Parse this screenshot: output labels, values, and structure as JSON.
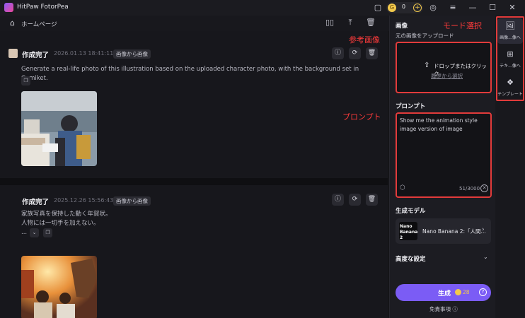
{
  "app": {
    "title": "HitPaw FotorPea"
  },
  "titlebar": {
    "coins": "0"
  },
  "toolbar": {
    "home_label": "ホームページ"
  },
  "cards": [
    {
      "status": "作成完了",
      "time": "2026.01.13 18:41:11",
      "badge": "画像から画像",
      "prompt": "Generate a real-life photo of this illustration based on the uploaded character photo, with the background set in Comiket."
    },
    {
      "status": "作成完了",
      "time": "2025.12.26 15:56:43",
      "badge": "画像から画像",
      "prompt_line1": "家族写真を保持した動く年賀状。",
      "prompt_line2": "人物には一切手を加えない。",
      "ellipsis": "..."
    }
  ],
  "panel": {
    "image_label": "画像",
    "upload_sub": "元の画像をアップロード",
    "upload_text": "ドロップまたはクリック",
    "upload_history": "履歴から選択",
    "prompt_label": "プロンプト",
    "prompt_value": "Show me the animation style image version of image",
    "prompt_count": "51/3000",
    "model_label": "生成モデル",
    "model_name": "Nano Banana 2:「人間...",
    "model_thumb_line1": "Nano",
    "model_thumb_line2": "Banana 2",
    "advanced_label": "高度な設定",
    "generate_label": "生成",
    "generate_cost": "28",
    "disclaimer": "免責事項"
  },
  "modes": [
    {
      "label": "画像...像へ"
    },
    {
      "label": "テキ...像へ"
    },
    {
      "label": "テンプレート"
    }
  ],
  "annotations": {
    "mode_select": "モード選択",
    "reference_image": "参考画像",
    "prompt": "プロンプト"
  },
  "colors": {
    "accent": "#7b5cf5",
    "annotation": "#e23b3b",
    "coin": "#f2c94c"
  }
}
